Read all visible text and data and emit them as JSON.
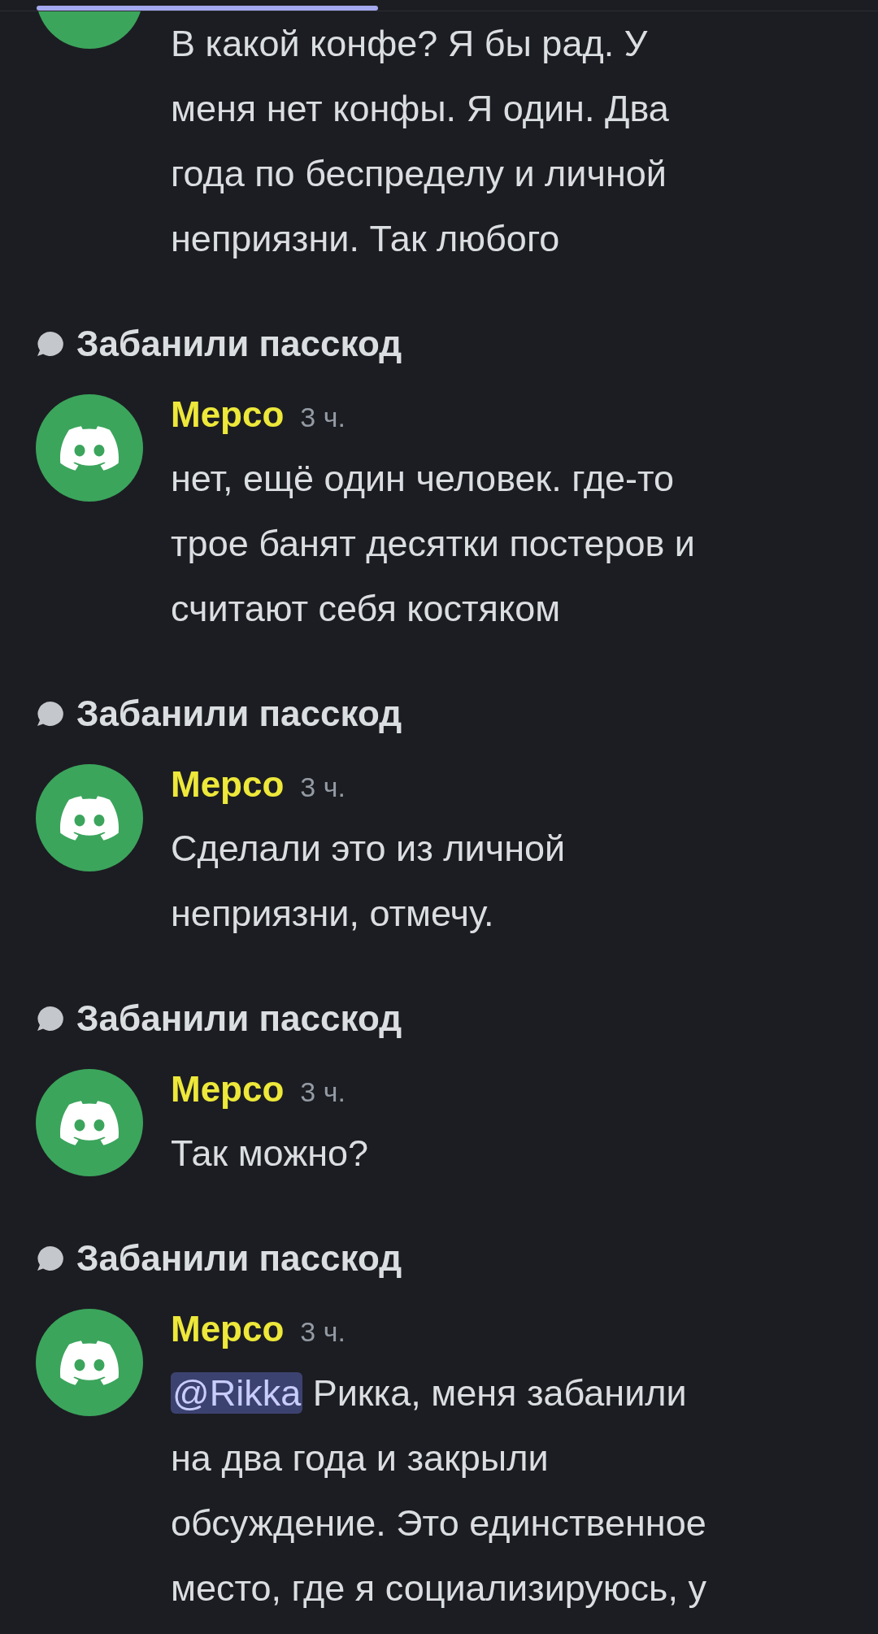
{
  "messages": [
    {
      "kind": "continuation",
      "body": "В какой конфе? Я бы рад. У\nменя нет конфы. Я один. Два\nгода по беспределу и личной\nнеприязни. Так любого"
    },
    {
      "kind": "thread",
      "thread_title": "Забанили пасскод",
      "author": "Мерсо",
      "time": "3 ч.",
      "body": "нет, ещё один человек. где-то\nтрое банят десятки постеров и\nсчитают себя костяком"
    },
    {
      "kind": "thread",
      "thread_title": "Забанили пасскод",
      "author": "Мерсо",
      "time": "3 ч.",
      "body": "Сделали это из личной\nнеприязни, отмечу."
    },
    {
      "kind": "thread",
      "thread_title": "Забанили пасскод",
      "author": "Мерсо",
      "time": "3 ч.",
      "body": "Так можно?"
    },
    {
      "kind": "thread",
      "thread_title": "Забанили пасскод",
      "author": "Мерсо",
      "time": "3 ч.",
      "mention": "@Rikka",
      "body": " Рикка, меня забанили\nна два года и закрыли\nобсуждение. Это единственное\nместо, где я социализируюсь, у"
    }
  ]
}
